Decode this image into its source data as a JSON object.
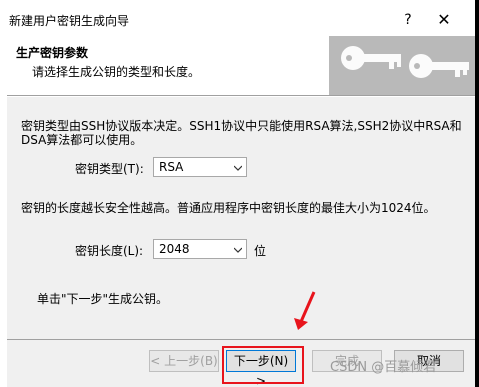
{
  "window": {
    "title": "新建用户密钥生成向导",
    "help_label": "?",
    "close_label": "✕"
  },
  "header": {
    "heading": "生产密钥参数",
    "subheading": "请选择生成公钥的类型和长度。",
    "art_icon": "keys-icon"
  },
  "body": {
    "type_description_line1": "密钥类型由SSH协议版本决定。SSH1协议中只能使用RSA算法,SSH2协议中RSA和",
    "type_description_line2": "DSA算法都可以使用。",
    "type_label": "密钥类型(T):",
    "type_value": "RSA",
    "length_description": "密钥的长度越长安全性越高。普通应用程序中密钥长度的最佳大小为1024位。",
    "length_label": "密钥长度(L):",
    "length_value": "2048",
    "length_unit": "位",
    "instruction": "单击\"下一步\"生成公钥。"
  },
  "footer": {
    "back_label": "< 上一步(B)",
    "next_label": "下一步(N) >",
    "finish_label": "完成",
    "cancel_label": "取消"
  },
  "annotation": {
    "highlight_color": "#e8141c"
  },
  "watermark": "CSDN @百慕倾君"
}
